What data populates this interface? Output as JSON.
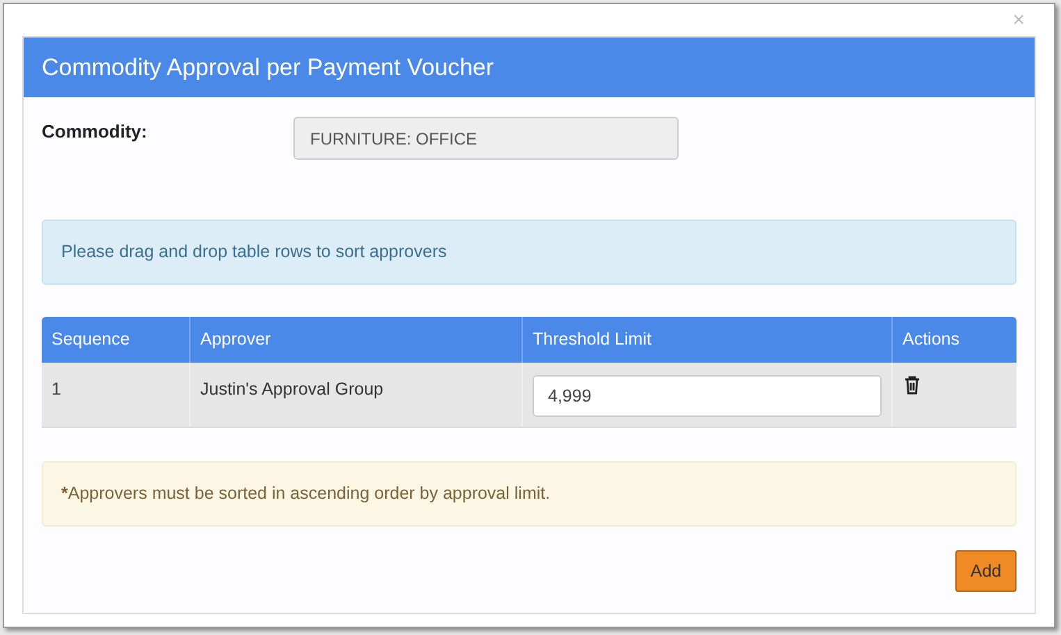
{
  "close": "×",
  "dialog": {
    "title": "Commodity Approval per Payment Voucher"
  },
  "commodity": {
    "label": "Commodity:",
    "value": "FURNITURE: OFFICE"
  },
  "info": "Please drag and drop table rows to sort approvers",
  "table": {
    "columns": [
      "Sequence",
      "Approver",
      "Threshold Limit",
      "Actions"
    ],
    "rows": [
      {
        "sequence": "1",
        "approver": "Justin's Approval Group",
        "threshold": "4,999"
      }
    ]
  },
  "note": {
    "mark": "*",
    "text": "Approvers must be sorted in ascending order by approval limit."
  },
  "buttons": [
    "Add"
  ]
}
